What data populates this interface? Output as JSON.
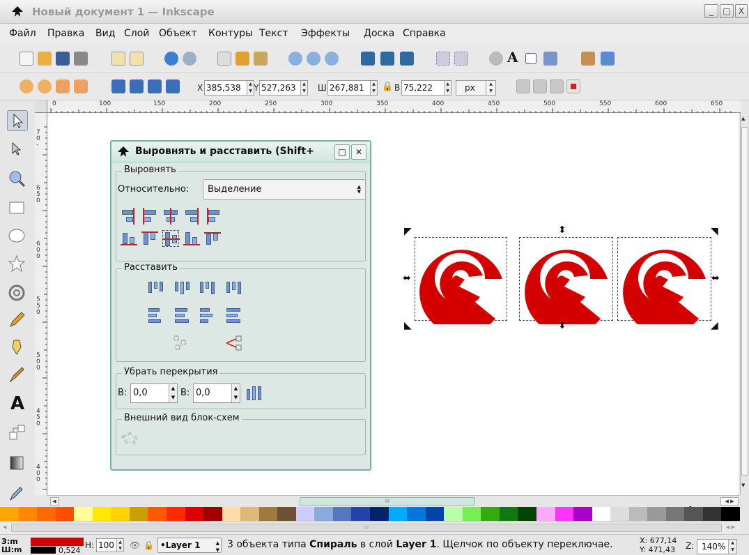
{
  "window": {
    "title": "Новый документ 1 — Inkscape",
    "buttons": [
      "_",
      "□",
      "X"
    ]
  },
  "menu": [
    {
      "label": "Файл"
    },
    {
      "label": "Правка"
    },
    {
      "label": "Вид"
    },
    {
      "label": "Слой"
    },
    {
      "label": "Объект"
    },
    {
      "label": "Контуры"
    },
    {
      "label": "Текст"
    },
    {
      "label": "Эффекты"
    },
    {
      "label": "Доска"
    },
    {
      "label": "Справка"
    }
  ],
  "selector_toolbar": {
    "x_label": "X",
    "x_value": "385,538",
    "y_label": "Y",
    "y_value": "527,263",
    "w_label": "Ш",
    "w_value": "267,881",
    "h_label": "В",
    "h_value": "75,222",
    "unit": "px"
  },
  "ruler": {
    "top_ticks": [
      "0",
      "100",
      "150",
      "200",
      "250",
      "300",
      "350",
      "400",
      "450",
      "500",
      "550",
      "600",
      "650"
    ],
    "left_ticks": [
      "7\n0\n-",
      "6\n5\n0",
      "6\n0\n0",
      "5\n5\n0",
      "5\n0\n0",
      "4\n5\n0",
      "4\n0\n0"
    ]
  },
  "dialog": {
    "title": "Выровнять и расставить (Shift+",
    "align_section": "Выровнять",
    "relative_label": "Относительно:",
    "relative_value": "Выделение",
    "distribute_section": "Расставить",
    "overlap_section": "Убрать перекрытия",
    "h_gap_label": "В:",
    "h_gap_value": "0,0",
    "v_gap_label": "В:",
    "v_gap_value": "0,0",
    "connectors_section": "Внешний вид блок-схем"
  },
  "palette": [
    "#ffa500",
    "#ff8800",
    "#ff6a00",
    "#ff4e00",
    "#fffc9a",
    "#ffe900",
    "#ffd200",
    "#c8a000",
    "#ff5a00",
    "#ff2a00",
    "#dd0000",
    "#a00000",
    "#ffdca8",
    "#e0b878",
    "#a07840",
    "#6e5032",
    "#ccccff",
    "#88aadd",
    "#5577bb",
    "#2244aa",
    "#002266",
    "#00aaff",
    "#0077dd",
    "#0044aa",
    "#bbffaa",
    "#77ee55",
    "#33aa11",
    "#117711",
    "#004400",
    "#ffaaff",
    "#ff33ff",
    "#aa00cc",
    "#ffffff",
    "#dddddd",
    "#bbbbbb",
    "#999999",
    "#777777",
    "#555555",
    "#333333",
    "#000000"
  ],
  "status": {
    "fill_label": "З:",
    "fill_value": "m",
    "stroke_label": "Ш:",
    "stroke_value": "m",
    "stroke_width": "0,524",
    "opacity_label": "Н:",
    "opacity_value": "100",
    "layer": "•Layer 1",
    "message_pre": "3 объекта типа ",
    "message_type": "Спираль",
    "message_mid": " в слой ",
    "message_layer": "Layer 1",
    "message_post": ". Щелчок по объекту переключае.",
    "cursor_x": "X: 677,14",
    "cursor_y": "Y: 471,43",
    "zoom_label": "Z:",
    "zoom_value": "140%"
  },
  "colors": {
    "spiral": "#d40000",
    "dialog_border": "#6fb7a4"
  }
}
